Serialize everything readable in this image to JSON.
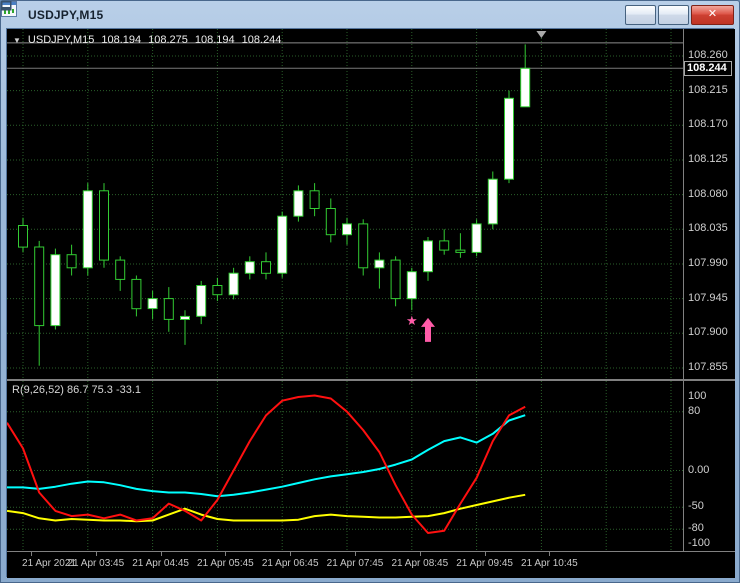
{
  "window": {
    "title": "USDJPY,M15"
  },
  "icons": {
    "app": "candlestick-chart-icon",
    "minimize": "minimize-icon",
    "maximize": "maximize-icon",
    "close": "✕",
    "expander": "▼",
    "star": "★",
    "arrow": "up-arrow-icon",
    "shift_marker": "chart-shift-marker"
  },
  "chart": {
    "symbol_header": {
      "symbol": "USDJPY,M15",
      "open": "108.194",
      "high": "108.275",
      "low": "108.194",
      "close": "108.244"
    },
    "indicator_label": "R(9,26,52) 86.7 75.3 -33.1"
  },
  "colors": {
    "bull": "#FFFFFF",
    "bear": "#000000",
    "outline": "#33CC33",
    "grid": "#2A5F2A",
    "bid_line": "#787878",
    "hline": "#8C8C8C",
    "marker": "#FF5CA8",
    "shift": "#AAAAAA"
  },
  "chart_data": {
    "type": "candlestick",
    "symbol": "USDJPY",
    "timeframe": "M15",
    "date": "21 Apr 2021",
    "price_axis": {
      "labels": [
        "108.260",
        "108.215",
        "108.170",
        "108.125",
        "108.080",
        "108.035",
        "107.990",
        "107.945",
        "107.900",
        "107.855"
      ],
      "ylim": [
        107.8407,
        108.295
      ],
      "current": "108.244",
      "hline": 108.277
    },
    "vgrid_indices": [
      1,
      5,
      9,
      13,
      17,
      21,
      25,
      29,
      33,
      37,
      41
    ],
    "candles": [
      {
        "t": "02:45",
        "o": 108.04,
        "h": 108.05,
        "l": 108.005,
        "c": 108.012
      },
      {
        "t": "03:00",
        "o": 108.012,
        "h": 108.02,
        "l": 107.858,
        "c": 107.91
      },
      {
        "t": "03:15",
        "o": 107.91,
        "h": 108.01,
        "l": 107.905,
        "c": 108.002
      },
      {
        "t": "03:30",
        "o": 108.002,
        "h": 108.015,
        "l": 107.975,
        "c": 107.985
      },
      {
        "t": "03:45",
        "o": 107.985,
        "h": 108.095,
        "l": 107.975,
        "c": 108.085
      },
      {
        "t": "04:00",
        "o": 108.085,
        "h": 108.095,
        "l": 107.985,
        "c": 107.995
      },
      {
        "t": "04:15",
        "o": 107.995,
        "h": 108.0,
        "l": 107.955,
        "c": 107.97
      },
      {
        "t": "04:30",
        "o": 107.97,
        "h": 107.975,
        "l": 107.922,
        "c": 107.932
      },
      {
        "t": "04:45",
        "o": 107.932,
        "h": 107.955,
        "l": 107.918,
        "c": 107.945
      },
      {
        "t": "05:00",
        "o": 107.945,
        "h": 107.96,
        "l": 107.902,
        "c": 107.918
      },
      {
        "t": "05:15",
        "o": 107.918,
        "h": 107.93,
        "l": 107.885,
        "c": 107.922
      },
      {
        "t": "05:30",
        "o": 107.922,
        "h": 107.968,
        "l": 107.912,
        "c": 107.962
      },
      {
        "t": "05:45",
        "o": 107.962,
        "h": 107.972,
        "l": 107.942,
        "c": 107.95
      },
      {
        "t": "06:00",
        "o": 107.95,
        "h": 107.985,
        "l": 107.944,
        "c": 107.978
      },
      {
        "t": "06:15",
        "o": 107.978,
        "h": 108.0,
        "l": 107.97,
        "c": 107.993
      },
      {
        "t": "06:30",
        "o": 107.993,
        "h": 108.005,
        "l": 107.97,
        "c": 107.978
      },
      {
        "t": "06:45",
        "o": 107.978,
        "h": 108.058,
        "l": 107.972,
        "c": 108.052
      },
      {
        "t": "07:00",
        "o": 108.052,
        "h": 108.092,
        "l": 108.045,
        "c": 108.085
      },
      {
        "t": "07:15",
        "o": 108.085,
        "h": 108.095,
        "l": 108.052,
        "c": 108.062
      },
      {
        "t": "07:30",
        "o": 108.062,
        "h": 108.075,
        "l": 108.018,
        "c": 108.028
      },
      {
        "t": "07:45",
        "o": 108.028,
        "h": 108.05,
        "l": 108.015,
        "c": 108.042
      },
      {
        "t": "08:00",
        "o": 108.042,
        "h": 108.048,
        "l": 107.975,
        "c": 107.985
      },
      {
        "t": "08:15",
        "o": 107.985,
        "h": 108.005,
        "l": 107.958,
        "c": 107.995
      },
      {
        "t": "08:30",
        "o": 107.995,
        "h": 108.0,
        "l": 107.935,
        "c": 107.945
      },
      {
        "t": "08:45",
        "o": 107.945,
        "h": 107.985,
        "l": 107.93,
        "c": 107.98
      },
      {
        "t": "09:00",
        "o": 107.98,
        "h": 108.025,
        "l": 107.968,
        "c": 108.02
      },
      {
        "t": "09:15",
        "o": 108.02,
        "h": 108.035,
        "l": 108.002,
        "c": 108.008
      },
      {
        "t": "09:30",
        "o": 108.008,
        "h": 108.03,
        "l": 107.998,
        "c": 108.005
      },
      {
        "t": "09:45",
        "o": 108.005,
        "h": 108.048,
        "l": 108.0,
        "c": 108.042
      },
      {
        "t": "10:00",
        "o": 108.042,
        "h": 108.11,
        "l": 108.035,
        "c": 108.1
      },
      {
        "t": "10:15",
        "o": 108.1,
        "h": 108.215,
        "l": 108.095,
        "c": 108.205
      },
      {
        "t": "10:30",
        "o": 108.194,
        "h": 108.275,
        "l": 108.194,
        "c": 108.244
      }
    ],
    "markers": {
      "star": {
        "candle": 25,
        "price": 107.916
      },
      "arrow": {
        "candle": 26,
        "price": 107.92
      }
    },
    "time_axis": {
      "labels": [
        {
          "text": "21 Apr 2021",
          "candle": 1
        },
        {
          "text": "21 Apr 03:45",
          "candle": 5
        },
        {
          "text": "21 Apr 04:45",
          "candle": 9
        },
        {
          "text": "21 Apr 05:45",
          "candle": 13
        },
        {
          "text": "21 Apr 06:45",
          "candle": 17
        },
        {
          "text": "21 Apr 07:45",
          "candle": 21
        },
        {
          "text": "21 Apr 08:45",
          "candle": 25
        },
        {
          "text": "21 Apr 09:45",
          "candle": 29
        },
        {
          "text": "21 Apr 10:45",
          "candle": 33
        }
      ]
    },
    "indicator": {
      "name": "R(9,26,52)",
      "values_text": "86.7 75.3 -33.1",
      "axis_labels": [
        {
          "text": "100",
          "v": 100
        },
        {
          "text": "80",
          "v": 80
        },
        {
          "text": "0.00",
          "v": 0
        },
        {
          "text": "-50",
          "v": -50
        },
        {
          "text": "-80",
          "v": -80
        },
        {
          "text": "-100",
          "v": -100
        }
      ],
      "levels": [
        80,
        0,
        -50,
        -80
      ],
      "series": [
        {
          "name": "yellow",
          "color": "#FFFF00",
          "values": [
            -55,
            -58,
            -65,
            -68,
            -66,
            -67,
            -68,
            -68,
            -69,
            -68,
            -60,
            -52,
            -60,
            -66,
            -68,
            -68,
            -68,
            -68,
            -67,
            -62,
            -60,
            -62,
            -63,
            -64,
            -64,
            -63,
            -62,
            -58,
            -52,
            -47,
            -42,
            -37,
            -33.1
          ]
        },
        {
          "name": "cyan",
          "color": "#00FFFF",
          "values": [
            -23,
            -23,
            -25,
            -22,
            -18,
            -15,
            -16,
            -20,
            -25,
            -28,
            -30,
            -30,
            -32,
            -35,
            -33,
            -30,
            -26,
            -22,
            -17,
            -12,
            -8,
            -5,
            -2,
            2,
            8,
            15,
            28,
            40,
            45,
            38,
            50,
            68,
            75.3
          ]
        },
        {
          "name": "red",
          "color": "#FF1010",
          "values": [
            65,
            30,
            -30,
            -55,
            -62,
            -60,
            -65,
            -60,
            -68,
            -65,
            -45,
            -55,
            -68,
            -40,
            0,
            40,
            75,
            95,
            100,
            102,
            98,
            80,
            55,
            25,
            -20,
            -60,
            -85,
            -82,
            -45,
            -10,
            40,
            75,
            86.7
          ]
        }
      ]
    }
  }
}
